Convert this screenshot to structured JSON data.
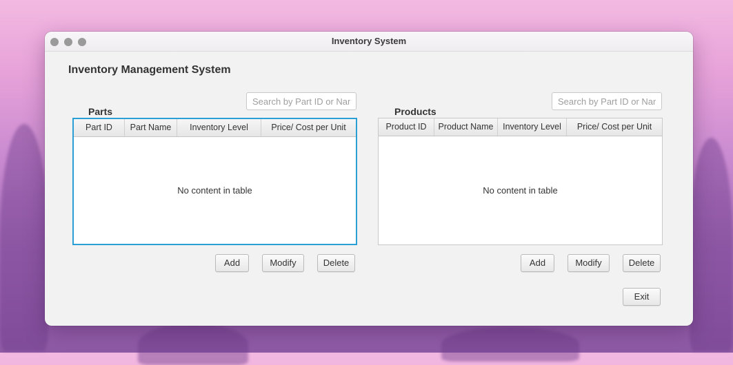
{
  "window": {
    "title": "Inventory System"
  },
  "app": {
    "title": "Inventory Management System"
  },
  "parts": {
    "label": "Parts",
    "search_placeholder": "Search by Part ID or Name",
    "columns": [
      "Part ID",
      "Part Name",
      "Inventory Level",
      "Price/ Cost per Unit"
    ],
    "empty_text": "No content in table",
    "buttons": {
      "add": "Add",
      "modify": "Modify",
      "delete": "Delete"
    }
  },
  "products": {
    "label": "Products",
    "search_placeholder": "Search by Part ID or Name",
    "columns": [
      "Product ID",
      "Product Name",
      "Inventory Level",
      "Price/ Cost per Unit"
    ],
    "empty_text": "No content in table",
    "buttons": {
      "add": "Add",
      "modify": "Modify",
      "delete": "Delete"
    }
  },
  "exit_label": "Exit",
  "colors": {
    "focus": "#2a9fd6",
    "traffic_light": "#9a9a9a"
  }
}
